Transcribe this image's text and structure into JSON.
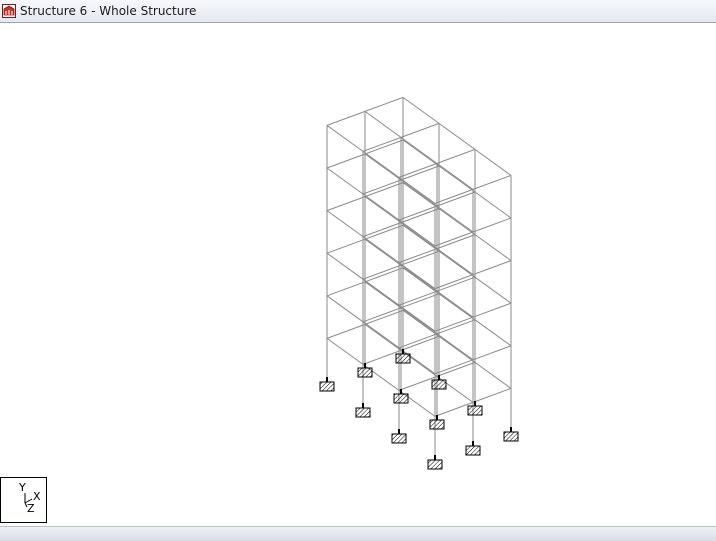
{
  "window": {
    "title": "Structure 6 - Whole Structure",
    "icon": "structure-app-icon"
  },
  "view": {
    "axes": {
      "y": "Y",
      "x": "X",
      "z": "Z"
    },
    "colors": {
      "member": "#8a8a8a",
      "support": "#000000",
      "background": "#ffffff"
    }
  }
}
